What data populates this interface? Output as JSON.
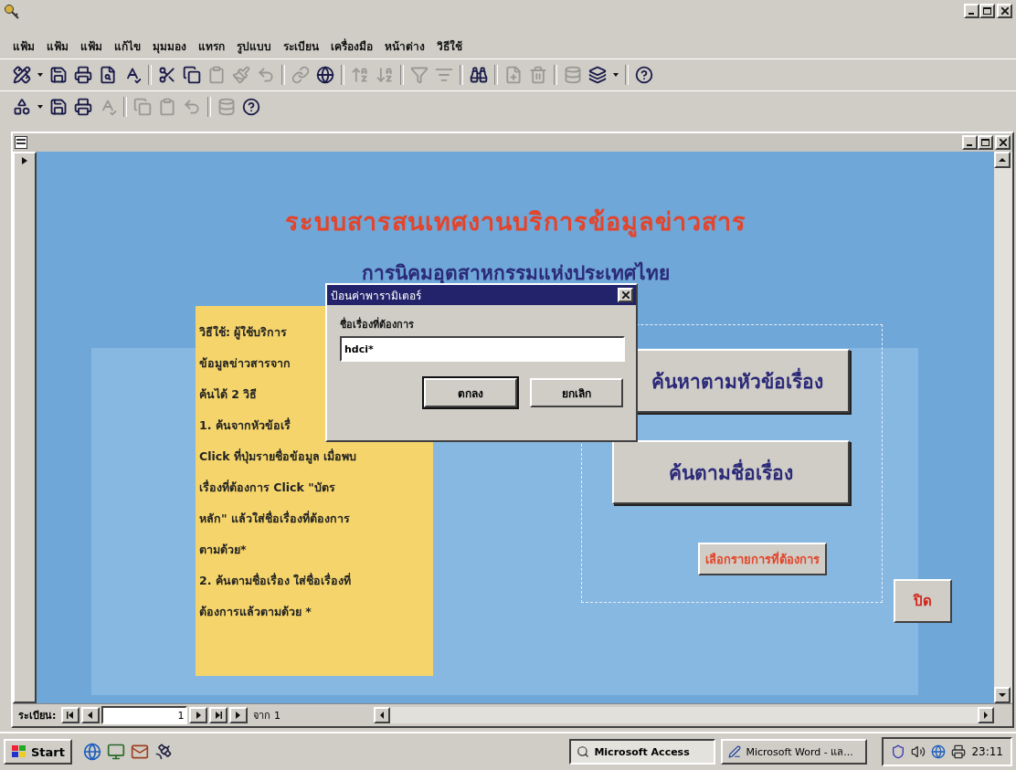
{
  "menu": [
    "แฟ้ม",
    "แฟ้ม",
    "แฟ้ม",
    "แก้ไข",
    "มุมมอง",
    "แทรก",
    "รูปแบบ",
    "ระเบียน",
    "เครื่องมือ",
    "หน้าต่าง",
    "วิธีใช้"
  ],
  "toolbars": [
    [
      {
        "kind": "view",
        "disabled": false
      },
      {
        "kind": "save",
        "disabled": false
      },
      {
        "kind": "print",
        "disabled": false
      },
      {
        "kind": "preview",
        "disabled": false
      },
      {
        "kind": "spell",
        "disabled": false
      },
      {
        "kind": "cut",
        "disabled": false
      },
      {
        "kind": "copy",
        "disabled": false
      },
      {
        "kind": "paste",
        "disabled": true
      },
      {
        "kind": "format",
        "disabled": true
      },
      {
        "kind": "undo",
        "disabled": true
      },
      {
        "kind": "hyperlink",
        "disabled": true
      },
      {
        "kind": "web",
        "disabled": false
      },
      {
        "kind": "sort-asc",
        "disabled": true
      },
      {
        "kind": "sort-desc",
        "disabled": true
      },
      {
        "kind": "filter",
        "disabled": true
      },
      {
        "kind": "filter-apply",
        "disabled": true
      },
      {
        "kind": "find",
        "disabled": false
      },
      {
        "kind": "new-record",
        "disabled": true
      },
      {
        "kind": "delete",
        "disabled": true
      },
      {
        "kind": "database",
        "disabled": true
      },
      {
        "kind": "new-object",
        "disabled": false
      },
      {
        "kind": "help",
        "disabled": false
      }
    ],
    [
      {
        "kind": "shapes",
        "disabled": false
      },
      {
        "kind": "save",
        "disabled": false
      },
      {
        "kind": "print",
        "disabled": false
      },
      {
        "kind": "spell",
        "disabled": true
      },
      {
        "kind": "copy",
        "disabled": true
      },
      {
        "kind": "paste",
        "disabled": true
      },
      {
        "kind": "undo",
        "disabled": true
      },
      {
        "kind": "database",
        "disabled": true
      },
      {
        "kind": "help",
        "disabled": false
      }
    ]
  ],
  "form": {
    "title": "ระบบสารสนเทศงานบริการข้อมูลข่าวสาร",
    "subtitle": "การนิคมอุตสาหกรรมแห่งประเทศไทย",
    "help_lines": [
      "วิธีใช้: ผู้ใช้บริการ",
      "ข้อมูลข่าวสารจาก",
      "ค้นได้ 2 วิธี",
      "1. ค้นจากหัวข้อเรื่",
      "Click ที่ปุ่มรายชื่อข้อมูล เมื่อพบ",
      "เรื่องที่ต้องการ    Click \"บัตร",
      "หลัก\"    แล้วใส่ชื่อเรื่องที่ต้องการ",
      "ตามด้วย*",
      "2. ค้นตามชื่อเรื่อง   ใส่ชื่อเรื่องที่",
      "ต้องการแล้วตามด้วย *"
    ],
    "search_buttons": [
      "ค้นหาตามหัวข้อเรื่อง",
      "ค้นตามชื่อเรื่อง"
    ],
    "select_button": "เลือกรายการที่ต้องการ",
    "close_button": "ปิด"
  },
  "dialog": {
    "title": "ป้อนค่าพารามิเตอร์",
    "label": "ชื่อเรื่องที่ต้องการ",
    "value": "hdci*",
    "buttons": [
      {
        "label": "ตกลง",
        "focused": true
      },
      {
        "label": "ยกเลิก",
        "focused": false
      }
    ]
  },
  "record_nav": {
    "label": "ระเบียน:",
    "current": "1",
    "total": "จาก 1"
  },
  "taskbar": {
    "start": "Start",
    "tasks": [
      {
        "label": "Microsoft Access",
        "selected": true
      },
      {
        "label": "Microsoft Word - แล...",
        "selected": false
      }
    ],
    "clock": "23:11"
  }
}
